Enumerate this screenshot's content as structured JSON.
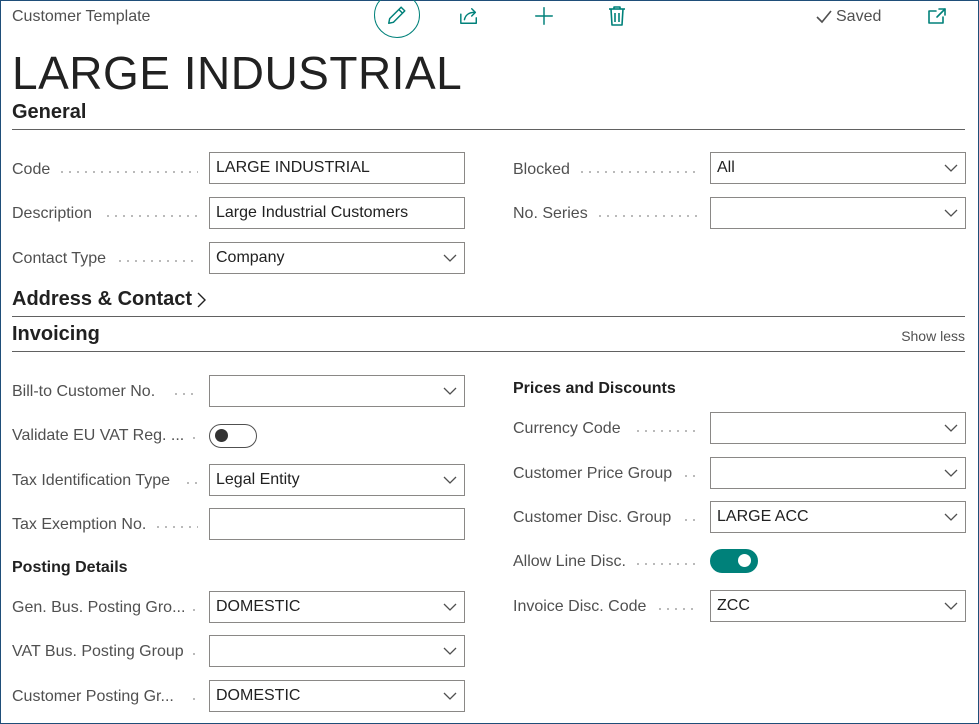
{
  "header": {
    "breadcrumb": "Customer Template",
    "saved_label": "Saved",
    "title": "LARGE INDUSTRIAL"
  },
  "general": {
    "title": "General",
    "code": {
      "label": "Code",
      "value": "LARGE INDUSTRIAL"
    },
    "description": {
      "label": "Description",
      "value": "Large Industrial Customers"
    },
    "contact_type": {
      "label": "Contact Type",
      "value": "Company"
    },
    "blocked": {
      "label": "Blocked",
      "value": "All"
    },
    "no_series": {
      "label": "No. Series",
      "value": ""
    }
  },
  "address": {
    "title": "Address & Contact"
  },
  "invoicing": {
    "title": "Invoicing",
    "show_less": "Show less",
    "bill_to": {
      "label": "Bill-to Customer No.",
      "value": ""
    },
    "validate_vat": {
      "label": "Validate EU VAT Reg. ...",
      "value": false
    },
    "tax_id_type": {
      "label": "Tax Identification Type",
      "value": "Legal Entity"
    },
    "tax_exemption": {
      "label": "Tax Exemption No.",
      "value": ""
    },
    "posting_details": {
      "title": "Posting Details",
      "gen_bus": {
        "label": "Gen. Bus. Posting Gro...",
        "value": "DOMESTIC"
      },
      "vat_bus": {
        "label": "VAT Bus. Posting Group",
        "value": ""
      },
      "customer_posting": {
        "label": "Customer Posting Gr...",
        "value": "DOMESTIC"
      }
    },
    "prices": {
      "title": "Prices and Discounts",
      "currency": {
        "label": "Currency Code",
        "value": ""
      },
      "price_group": {
        "label": "Customer Price Group",
        "value": ""
      },
      "disc_group": {
        "label": "Customer Disc. Group",
        "value": "LARGE ACC"
      },
      "allow_line_disc": {
        "label": "Allow Line Disc.",
        "value": true
      },
      "invoice_disc": {
        "label": "Invoice Disc. Code",
        "value": "ZCC"
      }
    }
  },
  "colors": {
    "accent": "#00817a",
    "border": "#1f4e79"
  }
}
